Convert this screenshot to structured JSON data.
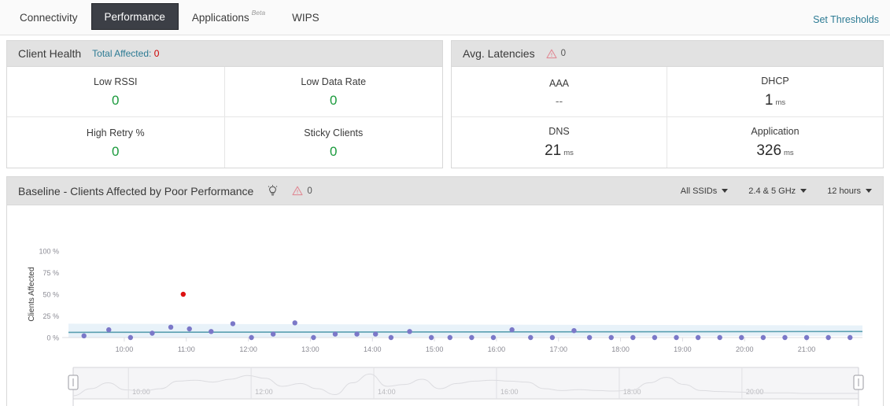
{
  "tabs": [
    {
      "label": "Connectivity",
      "active": false,
      "badge": ""
    },
    {
      "label": "Performance",
      "active": true,
      "badge": ""
    },
    {
      "label": "Applications",
      "active": false,
      "badge": "Beta"
    },
    {
      "label": "WIPS",
      "active": false,
      "badge": ""
    }
  ],
  "header": {
    "set_thresholds": "Set Thresholds"
  },
  "client_health": {
    "title": "Client Health",
    "total_affected_label": "Total Affected",
    "total_affected_sep": ":",
    "total_affected_value": "0",
    "metrics": [
      {
        "label": "Low RSSI",
        "value": "0",
        "unit": ""
      },
      {
        "label": "Low Data Rate",
        "value": "0",
        "unit": ""
      },
      {
        "label": "High Retry %",
        "value": "0",
        "unit": ""
      },
      {
        "label": "Sticky Clients",
        "value": "0",
        "unit": ""
      }
    ]
  },
  "avg_latencies": {
    "title": "Avg. Latencies",
    "warning_count": "0",
    "metrics": [
      {
        "label": "AAA",
        "value": "--",
        "unit": ""
      },
      {
        "label": "DHCP",
        "value": "1",
        "unit": "ms"
      },
      {
        "label": "DNS",
        "value": "21",
        "unit": "ms"
      },
      {
        "label": "Application",
        "value": "326",
        "unit": "ms"
      }
    ]
  },
  "baseline": {
    "title": "Baseline - Clients Affected by Poor Performance",
    "warning_count": "0",
    "filters": [
      {
        "label": "All SSIDs"
      },
      {
        "label": "2.4 & 5 GHz"
      },
      {
        "label": "12 hours"
      }
    ]
  },
  "colors": {
    "accent_link": "#2d7b94",
    "good_green": "#1a9a3c",
    "alert_red": "#cc0000",
    "point_purple": "#7b78c8",
    "baseline_teal": "#5a9fb0",
    "band_blue": "#e8f2f9",
    "panel_head_gray": "#e2e2e2",
    "active_tab_bg": "#3c3f46"
  },
  "chart_data": {
    "type": "scatter",
    "title": "Baseline - Clients Affected by Poor Performance",
    "xlabel": "",
    "ylabel": "Clients Affected",
    "ylim": [
      0,
      100
    ],
    "ytick_labels": [
      "0 %",
      "25 %",
      "50 %",
      "75 %",
      "100 %"
    ],
    "ytick_values": [
      0,
      25,
      50,
      75,
      100
    ],
    "xtick_labels": [
      "10:00",
      "11:00",
      "12:00",
      "13:00",
      "14:00",
      "15:00",
      "16:00",
      "17:00",
      "18:00",
      "19:00",
      "20:00",
      "21:00"
    ],
    "grid": false,
    "legend": "none",
    "series": [
      {
        "name": "Clients Affected",
        "color": "#7b78c8",
        "points": [
          {
            "x": 9.35,
            "y": 2
          },
          {
            "x": 9.75,
            "y": 9
          },
          {
            "x": 10.1,
            "y": 0
          },
          {
            "x": 10.45,
            "y": 5
          },
          {
            "x": 10.75,
            "y": 12
          },
          {
            "x": 11.05,
            "y": 10
          },
          {
            "x": 11.4,
            "y": 7
          },
          {
            "x": 11.75,
            "y": 16
          },
          {
            "x": 12.05,
            "y": 0
          },
          {
            "x": 12.4,
            "y": 4
          },
          {
            "x": 12.75,
            "y": 17
          },
          {
            "x": 13.05,
            "y": 0
          },
          {
            "x": 13.4,
            "y": 4
          },
          {
            "x": 13.75,
            "y": 4
          },
          {
            "x": 14.05,
            "y": 4
          },
          {
            "x": 14.3,
            "y": 0
          },
          {
            "x": 14.6,
            "y": 7
          },
          {
            "x": 14.95,
            "y": 0
          },
          {
            "x": 15.25,
            "y": 0
          },
          {
            "x": 15.6,
            "y": 0
          },
          {
            "x": 15.95,
            "y": 0
          },
          {
            "x": 16.25,
            "y": 9
          },
          {
            "x": 16.55,
            "y": 0
          },
          {
            "x": 16.9,
            "y": 0
          },
          {
            "x": 17.25,
            "y": 8
          },
          {
            "x": 17.5,
            "y": 0
          },
          {
            "x": 17.85,
            "y": 0
          },
          {
            "x": 18.2,
            "y": 0
          },
          {
            "x": 18.55,
            "y": 0
          },
          {
            "x": 18.9,
            "y": 0
          },
          {
            "x": 19.25,
            "y": 0
          },
          {
            "x": 19.6,
            "y": 0
          },
          {
            "x": 19.95,
            "y": 0
          },
          {
            "x": 20.3,
            "y": 0
          },
          {
            "x": 20.65,
            "y": 0
          },
          {
            "x": 21.0,
            "y": 0
          },
          {
            "x": 21.35,
            "y": 0
          },
          {
            "x": 21.7,
            "y": 0
          }
        ]
      },
      {
        "name": "Outlier",
        "color": "#dd1111",
        "points": [
          {
            "x": 10.95,
            "y": 50
          }
        ]
      }
    ],
    "baseline_band": {
      "color": "#e8f2f9",
      "upper_start": 16,
      "upper_end": 14,
      "lower_start": 0,
      "lower_end": 2
    },
    "baseline_line": {
      "color": "#5a9fb0",
      "start": 6,
      "end": 7
    },
    "navigator": {
      "xtick_labels": [
        "10:00",
        "12:00",
        "14:00",
        "16:00",
        "18:00",
        "20:00"
      ],
      "selection_start_pct": 0,
      "selection_end_pct": 100
    }
  }
}
